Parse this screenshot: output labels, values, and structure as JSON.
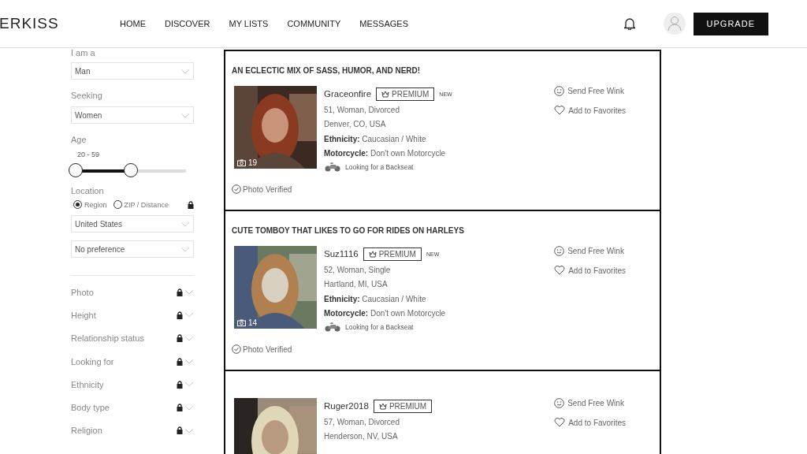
{
  "header": {
    "logo": "ERKISS",
    "nav": [
      {
        "label": "HOME"
      },
      {
        "label": "DISCOVER"
      },
      {
        "label": "MY LISTS"
      },
      {
        "label": "COMMUNITY"
      },
      {
        "label": "MESSAGES"
      }
    ],
    "upgrade": "UPGRADE"
  },
  "sidebar": {
    "iam": {
      "label": "I am a",
      "value": "Man"
    },
    "seeking": {
      "label": "Seeking",
      "value": "Women"
    },
    "age": {
      "label": "Age",
      "reading": "20 - 59",
      "thumbs": [
        {
          "level": 0
        },
        {
          "level": 0.5
        }
      ]
    },
    "location": {
      "label": "Location",
      "locked": true,
      "radios": [
        {
          "label": "Region",
          "selected": true
        },
        {
          "label": "ZIP / Distance",
          "selected": false
        }
      ],
      "selects": [
        "United States",
        "No preference"
      ]
    },
    "filters": [
      {
        "label": "Photo",
        "locked": true
      },
      {
        "label": "Height",
        "locked": true
      },
      {
        "label": "Relationship status",
        "locked": true
      },
      {
        "label": "Looking for",
        "locked": true
      },
      {
        "label": "Ethnicity",
        "locked": true
      },
      {
        "label": "Body type",
        "locked": true
      },
      {
        "label": "Religion",
        "locked": true
      }
    ]
  },
  "cards": [
    {
      "headline": "AN ECLECTIC MIX OF SASS, HUMOR, AND NERD!",
      "name": "Graceonfire",
      "badge": "PREMIUM",
      "new_tag": "NEW",
      "photo_count": "19",
      "details": [
        "51, Woman, Divorced",
        "Denver, CO, USA",
        "**Ethnicity:** Caucasian / White",
        "**Motorcycle:**  Don't own Motorcycle"
      ],
      "backseat": "Looking for a Backseat",
      "verified": "Photo Verified",
      "actions": [
        "Send Free Wink",
        "Add to Favorites"
      ]
    },
    {
      "headline": "CUTE TOMBOY THAT LIKES TO GO FOR RIDES ON HARLEYS",
      "name": "Suz1116",
      "badge": "PREMIUM",
      "new_tag": "NEW",
      "photo_count": "14",
      "details": [
        "52, Woman, Single",
        "Hartland, MI, USA",
        "**Ethnicity:** Caucasian / White",
        "**Motorcycle:**  Don't own Motorcycle"
      ],
      "backseat": "Looking for a Backseat",
      "verified": "Photo Verified",
      "actions": [
        "Send Free Wink",
        "Add to Favorites"
      ]
    },
    {
      "name": "Ruger2018",
      "badge": "PREMIUM",
      "details": [
        "57, Woman, Divorced",
        "Henderson, NV, USA"
      ],
      "actions": [
        "Send Free Wink",
        "Add to Favorites"
      ]
    }
  ]
}
